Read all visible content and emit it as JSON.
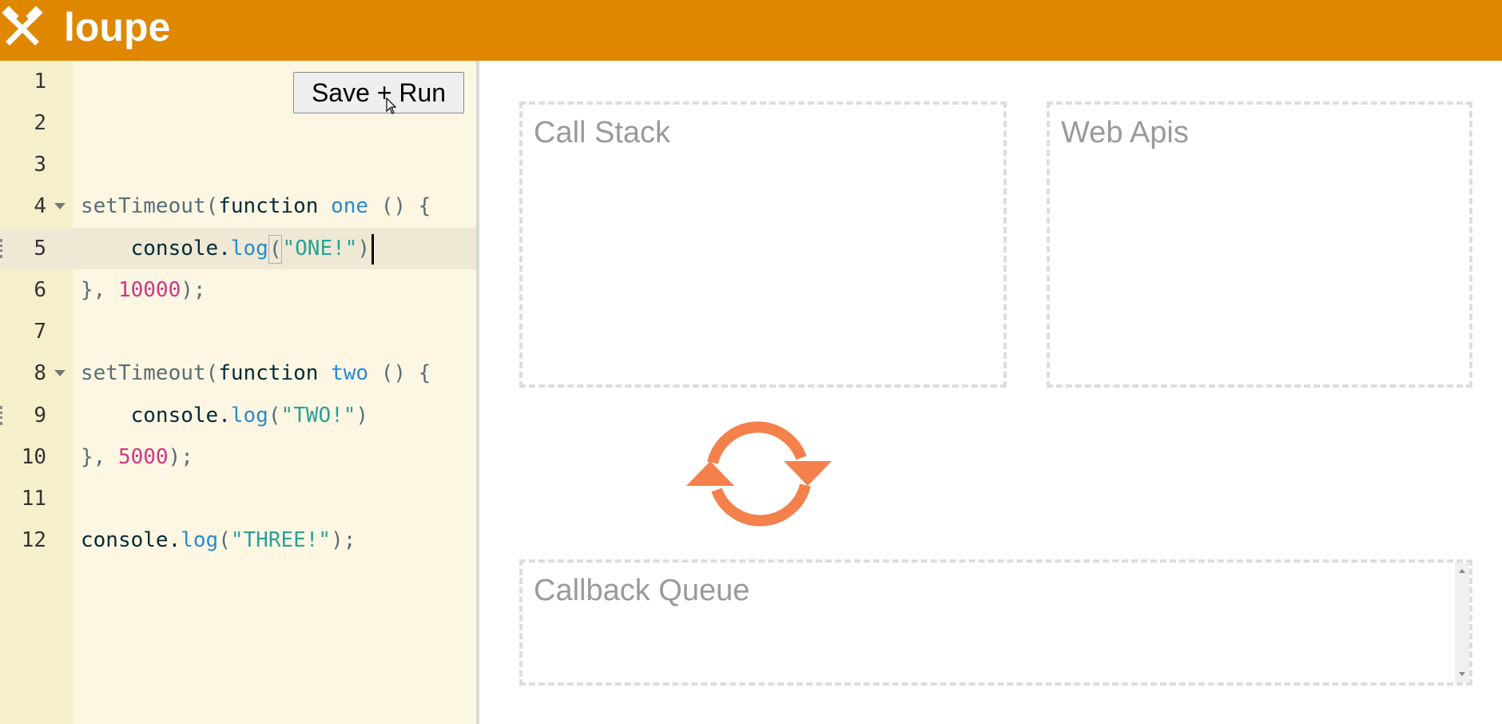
{
  "app": {
    "title": "loupe",
    "logo_icon": "tools-icon",
    "brand_color": "#df8700"
  },
  "editor": {
    "run_button_label": "Save + Run",
    "active_line": 5,
    "line_numbers": [
      "1",
      "2",
      "3",
      "4",
      "5",
      "6",
      "7",
      "8",
      "9",
      "10",
      "11",
      "12"
    ],
    "code": {
      "l4": {
        "a": "setTimeout(",
        "b": "function",
        "c": " ",
        "d": "one",
        "e": " () {"
      },
      "l5": {
        "indent": "    ",
        "a": "console.",
        "b": "log",
        "c": "(",
        "d": "\"ONE!\"",
        "e": ")"
      },
      "l6": {
        "a": "}, ",
        "b": "10000",
        "c": ");"
      },
      "l8": {
        "a": "setTimeout(",
        "b": "function",
        "c": " ",
        "d": "two",
        "e": " () {"
      },
      "l9": {
        "indent": "    ",
        "a": "console.",
        "b": "log",
        "c": "(",
        "d": "\"TWO!\"",
        "e": ")"
      },
      "l10": {
        "a": "}, ",
        "b": "5000",
        "c": ");"
      },
      "l12": {
        "a": "console.",
        "b": "log",
        "c": "(",
        "d": "\"THREE!\"",
        "e": ");"
      }
    }
  },
  "panels": {
    "call_stack": "Call Stack",
    "web_apis": "Web Apis",
    "callback_queue": "Callback Queue"
  },
  "event_loop": {
    "icon": "event-loop-refresh-icon",
    "color": "#f4804c"
  }
}
